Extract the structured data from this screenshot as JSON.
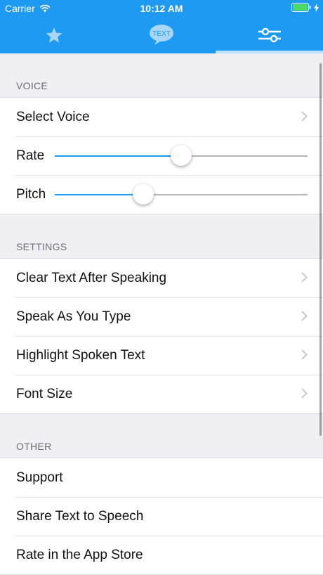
{
  "status_bar": {
    "carrier": "Carrier",
    "time": "10:12 AM"
  },
  "tabs": [
    {
      "icon": "star-icon"
    },
    {
      "icon": "text-bubble-icon",
      "label": "TEXT"
    },
    {
      "icon": "sliders-icon",
      "selected": true
    }
  ],
  "colors": {
    "accent": "#1e9af3",
    "background": "#efeff4",
    "battery": "#4cd964"
  },
  "sections": {
    "voice": {
      "header": "VOICE",
      "select_voice": "Select Voice",
      "rate": {
        "label": "Rate",
        "value": 0.5
      },
      "pitch": {
        "label": "Pitch",
        "value": 0.35
      }
    },
    "settings": {
      "header": "SETTINGS",
      "items": [
        "Clear Text After Speaking",
        "Speak As You Type",
        "Highlight Spoken Text",
        "Font Size"
      ]
    },
    "other": {
      "header": "OTHER",
      "items": [
        "Support",
        "Share Text to Speech",
        "Rate in the App Store"
      ]
    }
  }
}
